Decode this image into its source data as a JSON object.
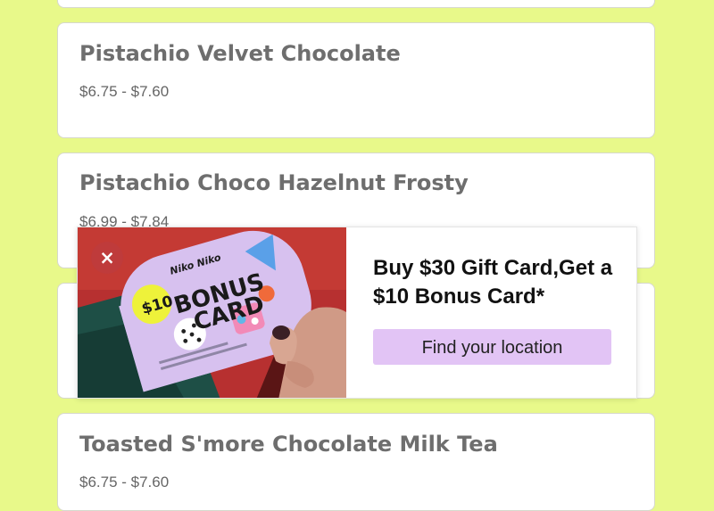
{
  "menu": {
    "items": [
      {
        "title": "",
        "price": ""
      },
      {
        "title": "Pistachio Velvet Chocolate",
        "price": "$6.75 - $7.60"
      },
      {
        "title": "Pistachio Choco Hazelnut Frosty",
        "price": "$6.99 - $7.84"
      },
      {
        "title": "",
        "price": ""
      },
      {
        "title": "Toasted S'more Chocolate Milk Tea",
        "price": "$6.75 - $7.60"
      }
    ]
  },
  "popup": {
    "close_icon": "close-icon",
    "close_symbol": "×",
    "headline": "Buy $30 Gift Card,Get a $10 Bonus Card*",
    "button_label": "Find your location",
    "image": {
      "description_icon": "gift-card-photo",
      "brand": "Niko Niko",
      "badge": "$10",
      "card_text_line1": "BONUS",
      "card_text_line2": "CARD"
    }
  },
  "colors": {
    "page_background": "#e8f98a",
    "button_background": "#e2c4f5",
    "image_background": "#b32b2b"
  }
}
